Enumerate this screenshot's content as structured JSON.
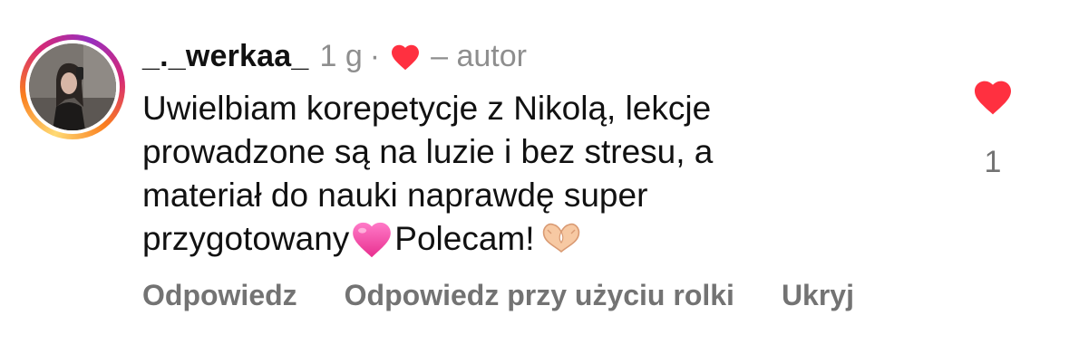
{
  "comment": {
    "username": "_._werkaa_",
    "time": "1 g",
    "separator": "·",
    "author_label": "– autor",
    "text_lines": [
      "Uwielbiam korepetycje z Nikolą, lekcje",
      "prowadzone są na luzie i bez stresu, a",
      "materiał do nauki naprawdę super"
    ],
    "text_last_before_emoji": "przygotowany",
    "text_last_after_emoji": "Polecam!",
    "emojis": [
      "pink-heart-icon",
      "heart-hands-icon"
    ],
    "actions": {
      "reply": "Odpowiedz",
      "reply_reel": "Odpowiedz przy użyciu rolki",
      "hide": "Ukryj"
    },
    "like_count": "1",
    "colors": {
      "like_red": "#ff3040",
      "secondary_text": "#8e8e8e",
      "action_text": "#737373"
    },
    "icons": {
      "author_like": "heart-icon",
      "like_button": "heart-filled-icon"
    }
  }
}
